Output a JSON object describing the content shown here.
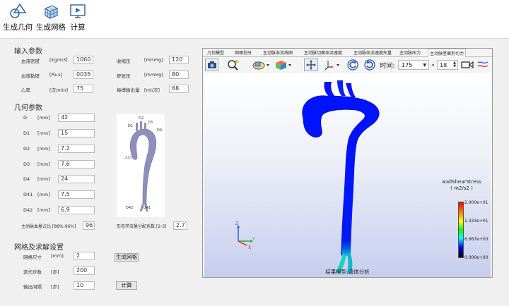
{
  "ribbon": {
    "items": [
      {
        "label": "生成几何",
        "icon": "geometry-icon"
      },
      {
        "label": "生成网格",
        "icon": "mesh-cube-icon"
      },
      {
        "label": "计算",
        "icon": "play-monitor-icon"
      }
    ]
  },
  "input_params": {
    "title": "输入参数",
    "rows": [
      {
        "label": "血液密度",
        "unit": "[kg/m3]",
        "value": "1060"
      },
      {
        "label": "收缩压",
        "unit": "[mmHg]",
        "value": "120"
      },
      {
        "label": "血液黏度",
        "unit": "[Pa.s]",
        "value": "0035"
      },
      {
        "label": "舒张压",
        "unit": "[mmHg]",
        "value": "80"
      },
      {
        "label": "心率",
        "unit": "[次/min]",
        "value": "75"
      },
      {
        "label": "每搏输出量",
        "unit": "[ml/次]",
        "value": "68"
      }
    ]
  },
  "geometry_params": {
    "title": "几何参数",
    "rows": [
      {
        "label": "D",
        "unit": "[mm]",
        "value": "42"
      },
      {
        "label": "D1",
        "unit": "[mm]",
        "value": "15"
      },
      {
        "label": "D2",
        "unit": "[mm]",
        "value": "7.2"
      },
      {
        "label": "D3",
        "unit": "[mm]",
        "value": "7.6"
      },
      {
        "label": "D4",
        "unit": "[mm]",
        "value": "24"
      },
      {
        "label": "D41",
        "unit": "[mm]",
        "value": "7.5"
      },
      {
        "label": "D42",
        "unit": "[mm]",
        "value": "6.9"
      }
    ],
    "ratio_label": "主动脉血量占比 [88%-96%]",
    "ratio_value": "96",
    "factor_label": "形态学流量分配系数 [2-3]",
    "factor_value": "2.7",
    "diagram_labels": {
      "d1": "D1",
      "d2": "D2",
      "d3": "D3",
      "d4": "D4",
      "inlet": "入口",
      "d41": "D41",
      "d42": "D42"
    }
  },
  "mesh_params": {
    "title": "网格及求解设置",
    "rows": [
      {
        "label": "网格尺寸",
        "unit": "[mm]",
        "value": "2"
      },
      {
        "label": "迭代步数",
        "unit": "[步]",
        "value": "200"
      },
      {
        "label": "输出间隔",
        "unit": "[步]",
        "value": "10"
      }
    ],
    "mesh_button": "生成网格",
    "calc_button": "计算"
  },
  "tabs": [
    "几何模型",
    "网格划分",
    "主动脉血流线图",
    "主动脉切面血流速度",
    "主动脉血流速度矢量",
    "主动脉压力",
    "主动脉壁面剪切力"
  ],
  "active_tab": 6,
  "toolbar": {
    "time_label": "时间:",
    "time_value": "175",
    "step_value": "18"
  },
  "viewport": {
    "caption": "结果模型:流体分析",
    "legend_title_line1": "wallShearStress",
    "legend_title_line2": "( m2/s2 )",
    "ticks": [
      "2.000e+01",
      "1.333e+01",
      "6.667e+00",
      "0.000e+00"
    ],
    "axis_labels": {
      "x": "X",
      "y": "Y",
      "z": "Z"
    }
  }
}
